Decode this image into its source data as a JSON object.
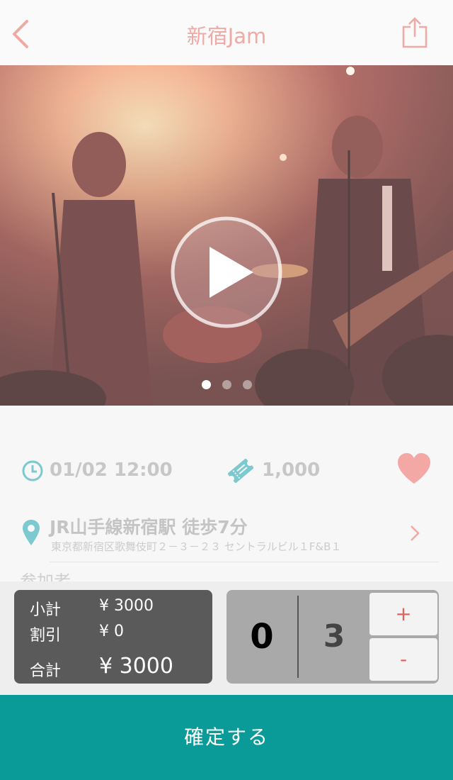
{
  "navbar": {
    "title": "新宿Jam",
    "back_icon": "chevron-left-icon",
    "share_icon": "share-icon",
    "accent_color": "#f0a9a5"
  },
  "hero": {
    "play_icon": "play-icon",
    "carousel_pages": 3,
    "carousel_active_index": 0
  },
  "event": {
    "datetime": "01/02 12:00",
    "price": "1,000",
    "clock_icon": "clock-icon",
    "ticket_icon": "ticket-icon",
    "favorite_icon": "heart-icon",
    "icon_color": "#7cc9cf",
    "heart_color": "#f4a8a5"
  },
  "location": {
    "title": "JR山手線新宿駅 徒歩7分",
    "address": "東京都新宿区歌舞伎町２－３－２３ セントラルビル１F&B１",
    "pin_icon": "map-pin-icon",
    "chevron_icon": "chevron-right-icon"
  },
  "participants": {
    "label": "参加者"
  },
  "totals": {
    "subtotal_label": "小計",
    "subtotal_value": "¥ 3000",
    "discount_label": "割引",
    "discount_value": "¥ 0",
    "total_label": "合計",
    "total_value": "¥ 3000"
  },
  "counter": {
    "left_value": "0",
    "right_value": "3",
    "plus_label": "+",
    "minus_label": "-"
  },
  "confirm_button": {
    "label": "確定する",
    "color": "#0a9a98"
  }
}
